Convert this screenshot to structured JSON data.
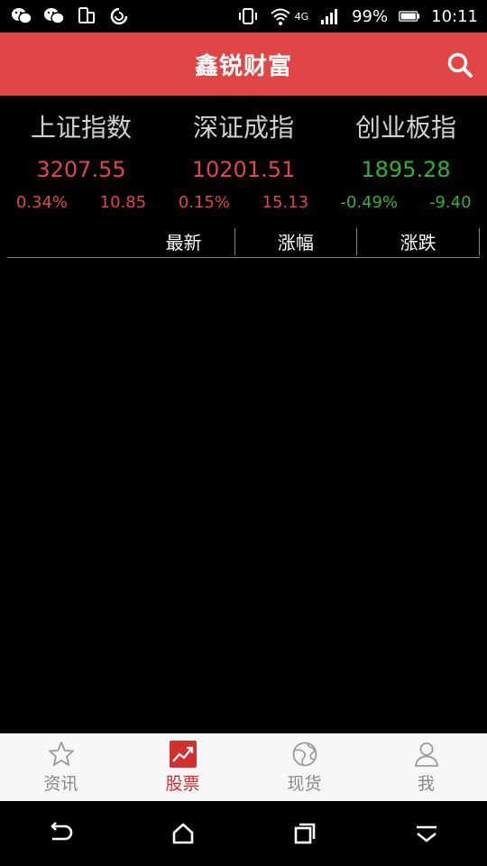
{
  "status_bar": {
    "battery_percent": "99%",
    "time": "10:11",
    "network_badge": "4G",
    "icons_left": [
      "wechat-icon",
      "wechat-icon",
      "phone-screen-icon",
      "sync-icon"
    ],
    "icons_right": [
      "vibrate-icon",
      "wifi-icon",
      "signal-icon",
      "battery-icon"
    ]
  },
  "header": {
    "title": "鑫锐财富",
    "background_color": "#e04646"
  },
  "indices": [
    {
      "name": "上证指数",
      "value": "3207.55",
      "change_pct": "0.34%",
      "change": "10.85",
      "trend": "up"
    },
    {
      "name": "深证成指",
      "value": "10201.51",
      "change_pct": "0.15%",
      "change": "15.13",
      "trend": "up"
    },
    {
      "name": "创业板指",
      "value": "1895.28",
      "change_pct": "-0.49%",
      "change": "-9.40",
      "trend": "down"
    }
  ],
  "table_header": {
    "latest": "最新",
    "change_pct": "涨幅",
    "change": "涨跌"
  },
  "tab_bar": {
    "items": [
      {
        "label": "资讯",
        "icon": "star-icon",
        "active": false
      },
      {
        "label": "股票",
        "icon": "stock-chart-icon",
        "active": true
      },
      {
        "label": "现货",
        "icon": "globe-icon",
        "active": false
      },
      {
        "label": "我",
        "icon": "user-icon",
        "active": false
      }
    ]
  },
  "nav_bar": {
    "icons": [
      "back-icon",
      "home-icon",
      "recents-icon",
      "hide-keyboard-icon"
    ]
  },
  "colors": {
    "up": "#e04646",
    "down": "#2fb236",
    "active_tab": "#d32f2f"
  }
}
